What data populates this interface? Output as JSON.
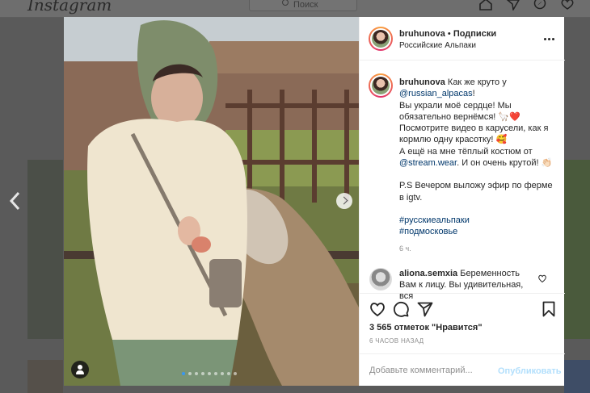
{
  "background": {
    "logo": "Instagram",
    "search_placeholder": "Поиск",
    "nav_icons": [
      "home-icon",
      "explore-icon",
      "compass-icon",
      "heart-icon"
    ]
  },
  "post": {
    "header": {
      "username": "bruhunova",
      "separator": "•",
      "follow_label": "Подписки",
      "location": "Российские Альпаки",
      "more_icon": "more-options-icon"
    },
    "caption": {
      "username": "bruhunova",
      "text_before_mention": "Как же круто у",
      "mention": "@russian_alpacas",
      "text_after_mention": "!",
      "line2": "Вы украли моё сердце! Мы обязательно вернёмся! 🦙❤️",
      "line3": "Посмотрите видео в карусели, как я кормлю одну красотку! 🥰",
      "line4_before": "А ещё на мне тёплый костюм от",
      "line4_mention": "@stream.wear",
      "line4_after": ". И он очень крутой! 👏🏻",
      "ps": "P.S Вечером выложу эфир по ферме в igtv.",
      "hashtag1": "#русскиеальпаки",
      "hashtag2": "#подмосковье",
      "time": "6 ч."
    },
    "comment": {
      "username": "aliona.semxia",
      "text": "Беременность Вам к лицу. Вы удивительная, вся"
    },
    "likes": "3 565 отметок \"Нравится\"",
    "posted_ago": "6 ЧАСОВ НАЗАД",
    "add_comment_placeholder": "Добавьте комментарий...",
    "publish_label": "Опубликовать",
    "carousel": {
      "count": 9,
      "active_index": 0
    }
  },
  "colors": {
    "link": "#00376b",
    "publish_disabled": "#b2dffc",
    "carousel_active": "#3897f0"
  }
}
